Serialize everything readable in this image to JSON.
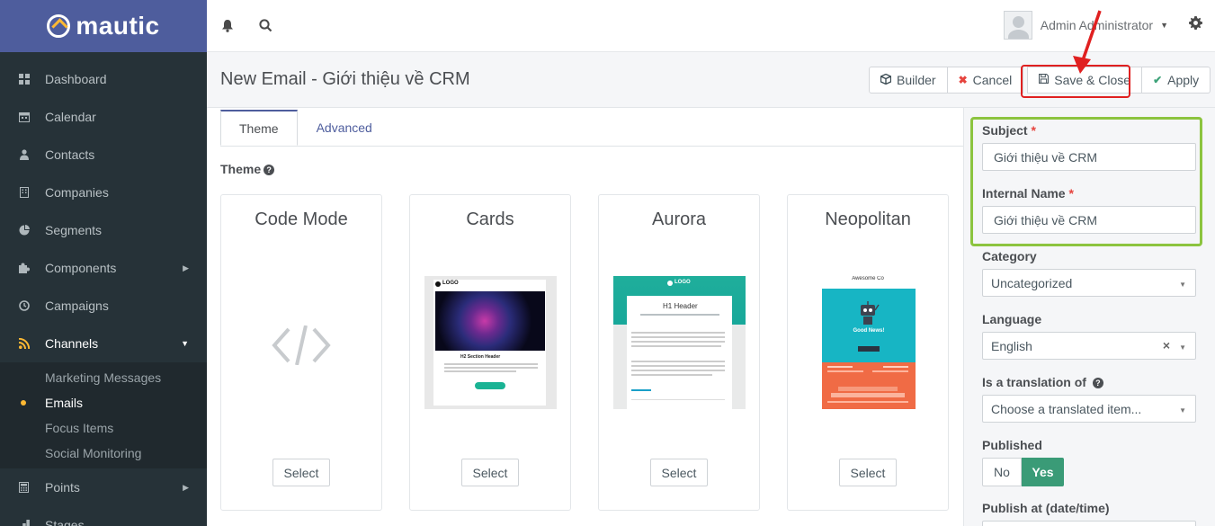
{
  "brand": {
    "name": "mautic"
  },
  "sidebar": {
    "items": [
      {
        "label": "Dashboard",
        "icon": "dashboard-icon"
      },
      {
        "label": "Calendar",
        "icon": "calendar-icon"
      },
      {
        "label": "Contacts",
        "icon": "user-icon"
      },
      {
        "label": "Companies",
        "icon": "building-icon"
      },
      {
        "label": "Segments",
        "icon": "pie-chart-icon"
      },
      {
        "label": "Components",
        "icon": "puzzle-icon"
      },
      {
        "label": "Campaigns",
        "icon": "clock-icon"
      },
      {
        "label": "Channels",
        "icon": "rss-icon"
      },
      {
        "label": "Points",
        "icon": "calculator-icon"
      },
      {
        "label": "Stages",
        "icon": "stages-icon"
      }
    ],
    "channels_sub": [
      {
        "label": "Marketing Messages"
      },
      {
        "label": "Emails"
      },
      {
        "label": "Focus Items"
      },
      {
        "label": "Social Monitoring"
      }
    ]
  },
  "topbar": {
    "user_name": "Admin Administrator"
  },
  "header": {
    "title": "New Email - Giới thiệu về CRM",
    "builder": "Builder",
    "cancel": "Cancel",
    "save_close": "Save & Close",
    "apply": "Apply"
  },
  "tabs": [
    {
      "label": "Theme"
    },
    {
      "label": "Advanced"
    }
  ],
  "theme_section": {
    "label": "Theme",
    "cards": [
      {
        "title": "Code Mode",
        "select": "Select"
      },
      {
        "title": "Cards",
        "select": "Select",
        "logo": "LOGO",
        "section_header": "H2 Section Header"
      },
      {
        "title": "Aurora",
        "select": "Select",
        "logo": "LOGO",
        "header": "H1 Header"
      },
      {
        "title": "Neopolitan",
        "select": "Select",
        "company": "Awesome Co",
        "news": "Good News!"
      }
    ]
  },
  "right_panel": {
    "subject_label": "Subject",
    "subject_value": "Giới thiệu về CRM",
    "internal_name_label": "Internal Name",
    "internal_name_value": "Giới thiệu về CRM",
    "category_label": "Category",
    "category_value": "Uncategorized",
    "language_label": "Language",
    "language_value": "English",
    "translation_label": "Is a translation of",
    "translation_placeholder": "Choose a translated item...",
    "published_label": "Published",
    "published_no": "No",
    "published_yes": "Yes",
    "publish_at_label": "Publish at (date/time)"
  },
  "colors": {
    "brand": "#4e5d9d",
    "sidebar": "#263238",
    "accent": "#fdb933",
    "success": "#3a9b77",
    "annotation_red": "#e02020",
    "annotation_green": "#8cc43f"
  }
}
